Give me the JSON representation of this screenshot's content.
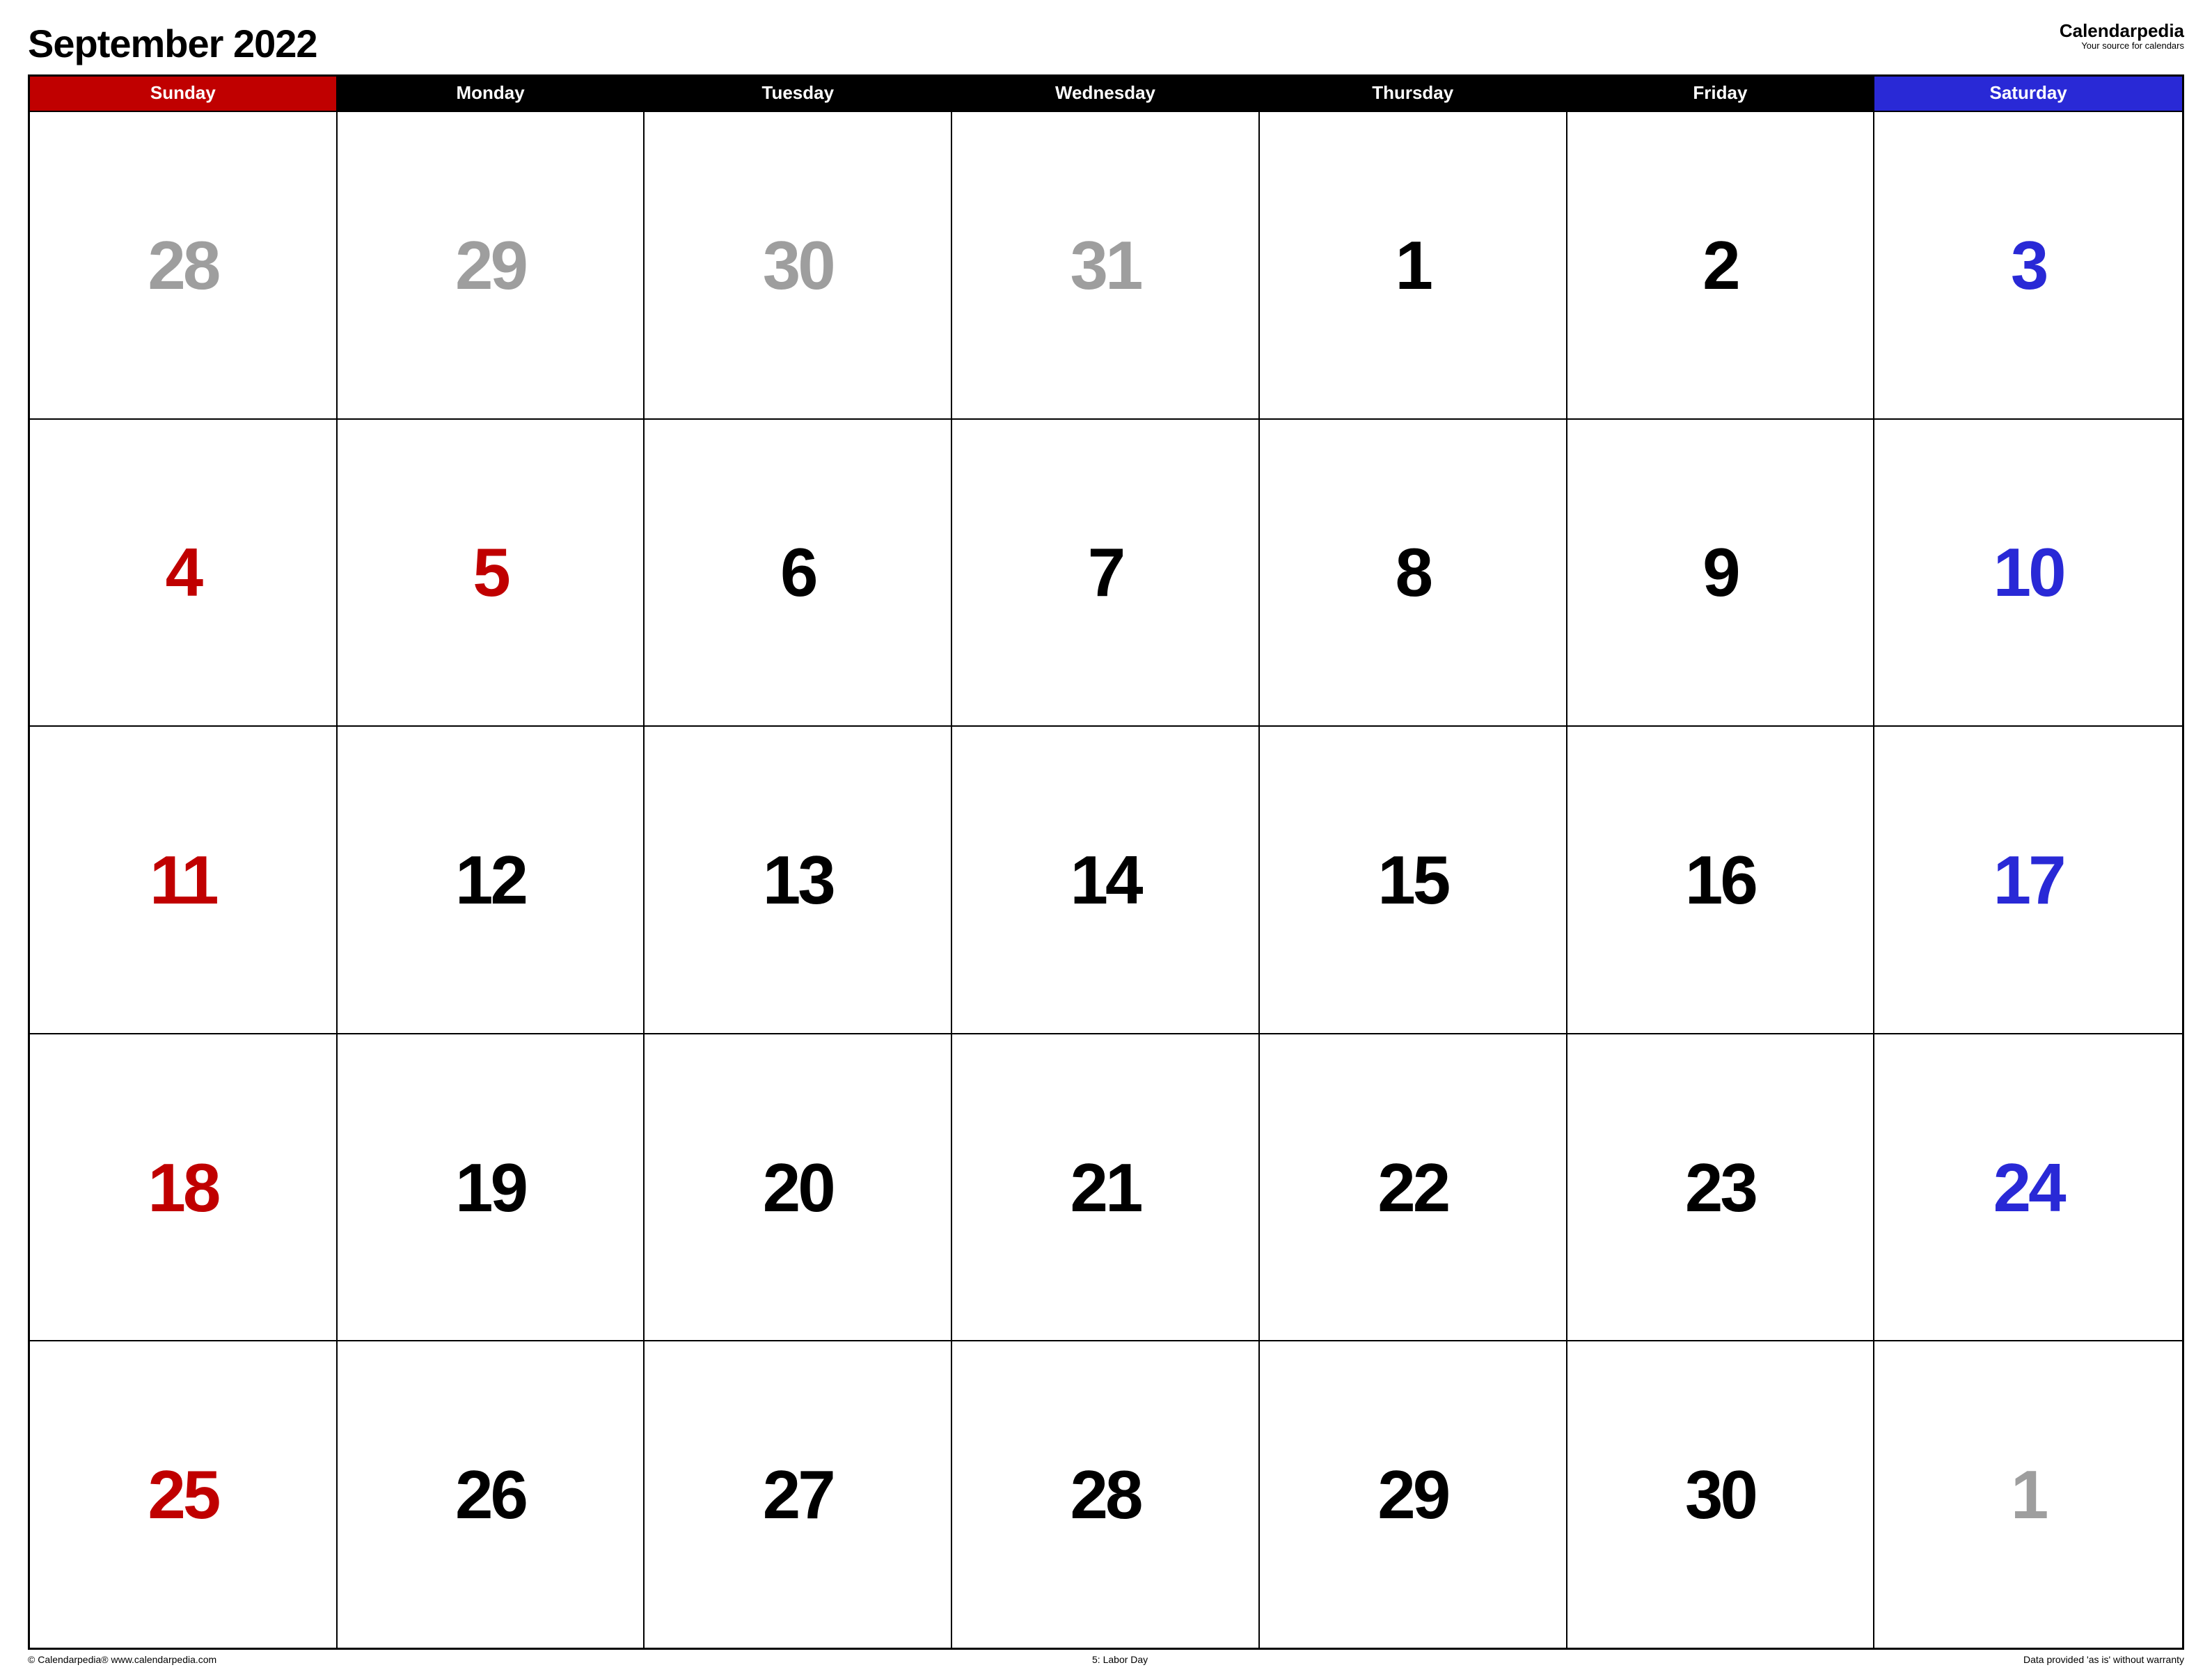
{
  "title": "September 2022",
  "brand": {
    "name": "Calendarpedia",
    "tagline": "Your source for calendars"
  },
  "days": [
    "Sunday",
    "Monday",
    "Tuesday",
    "Wednesday",
    "Thursday",
    "Friday",
    "Saturday"
  ],
  "colors": {
    "sunday": "#c00000",
    "saturday": "#2929d6",
    "weekday_header": "#000000",
    "prev_next_month": "#9e9e9e"
  },
  "cells": [
    {
      "n": "28",
      "k": "grey"
    },
    {
      "n": "29",
      "k": "grey"
    },
    {
      "n": "30",
      "k": "grey"
    },
    {
      "n": "31",
      "k": "grey"
    },
    {
      "n": "1",
      "k": "black"
    },
    {
      "n": "2",
      "k": "black"
    },
    {
      "n": "3",
      "k": "blue"
    },
    {
      "n": "4",
      "k": "red"
    },
    {
      "n": "5",
      "k": "red"
    },
    {
      "n": "6",
      "k": "black"
    },
    {
      "n": "7",
      "k": "black"
    },
    {
      "n": "8",
      "k": "black"
    },
    {
      "n": "9",
      "k": "black"
    },
    {
      "n": "10",
      "k": "blue"
    },
    {
      "n": "11",
      "k": "red"
    },
    {
      "n": "12",
      "k": "black"
    },
    {
      "n": "13",
      "k": "black"
    },
    {
      "n": "14",
      "k": "black"
    },
    {
      "n": "15",
      "k": "black"
    },
    {
      "n": "16",
      "k": "black"
    },
    {
      "n": "17",
      "k": "blue"
    },
    {
      "n": "18",
      "k": "red"
    },
    {
      "n": "19",
      "k": "black"
    },
    {
      "n": "20",
      "k": "black"
    },
    {
      "n": "21",
      "k": "black"
    },
    {
      "n": "22",
      "k": "black"
    },
    {
      "n": "23",
      "k": "black"
    },
    {
      "n": "24",
      "k": "blue"
    },
    {
      "n": "25",
      "k": "red"
    },
    {
      "n": "26",
      "k": "black"
    },
    {
      "n": "27",
      "k": "black"
    },
    {
      "n": "28",
      "k": "black"
    },
    {
      "n": "29",
      "k": "black"
    },
    {
      "n": "30",
      "k": "black"
    },
    {
      "n": "1",
      "k": "grey"
    }
  ],
  "footer": {
    "left": "© Calendarpedia®   www.calendarpedia.com",
    "mid": "5: Labor Day",
    "right": "Data provided 'as is' without warranty"
  }
}
